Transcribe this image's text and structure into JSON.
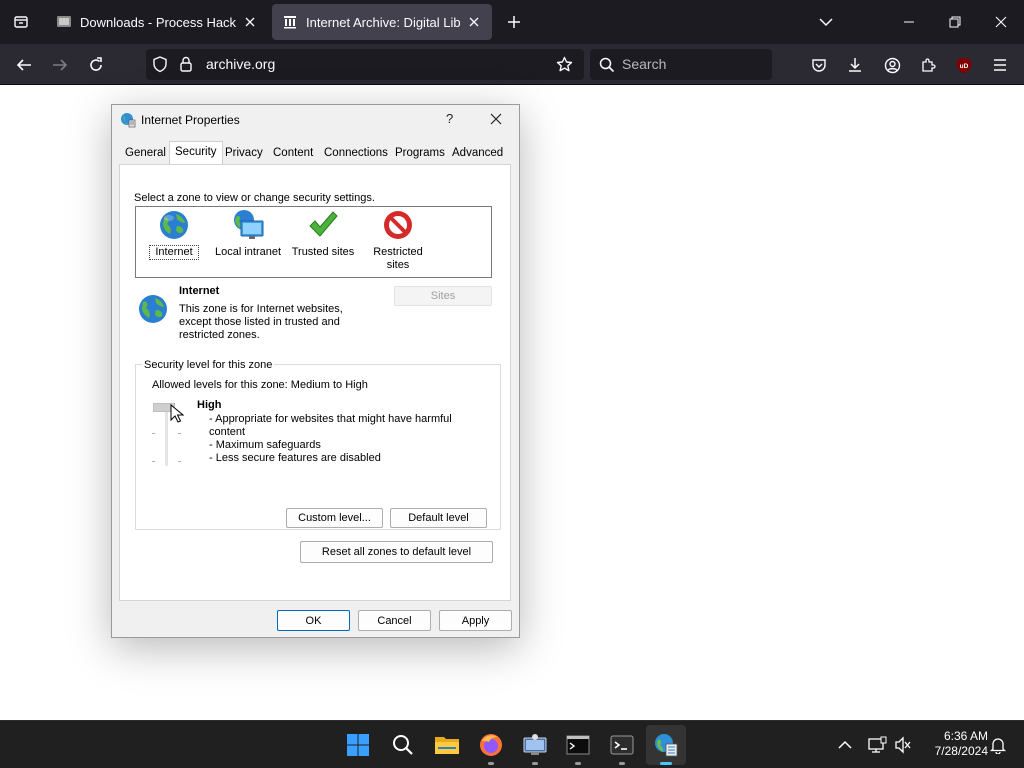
{
  "browser": {
    "tabs": [
      {
        "title": "Downloads - Process Hacker"
      },
      {
        "title": "Internet Archive: Digital Library"
      }
    ],
    "url": "archive.org",
    "search_placeholder": "Search",
    "ublock_badge": "uD"
  },
  "dialog": {
    "title": "Internet Properties",
    "help": "?",
    "tabs": [
      "General",
      "Security",
      "Privacy",
      "Content",
      "Connections",
      "Programs",
      "Advanced"
    ],
    "selected_tab": "Security",
    "zone_prompt": "Select a zone to view or change security settings.",
    "zones": [
      {
        "label": "Internet",
        "icon": "globe-icon"
      },
      {
        "label": "Local intranet",
        "icon": "intranet-icon"
      },
      {
        "label": "Trusted sites",
        "icon": "checkmark-icon"
      },
      {
        "label": "Restricted sites",
        "icon": "restricted-icon"
      }
    ],
    "zone_info": {
      "name": "Internet",
      "description_lines": [
        "This zone is for Internet websites,",
        "except those listed in trusted and",
        "restricted zones."
      ],
      "sites_button": "Sites"
    },
    "security_level": {
      "group_label": "Security level for this zone",
      "allowed": "Allowed levels for this zone: Medium to High",
      "level": "High",
      "details": [
        "- Appropriate for websites that might have harmful",
        "content",
        "- Maximum safeguards",
        "- Less secure features are disabled"
      ],
      "custom_button": "Custom level...",
      "default_button": "Default level"
    },
    "reset_button": "Reset all zones to default level",
    "ok": "OK",
    "cancel": "Cancel",
    "apply": "Apply"
  },
  "taskbar": {
    "time": "6:36 AM",
    "date": "7/28/2024",
    "apps": [
      "start-icon",
      "search-icon",
      "file-explorer-icon",
      "firefox-icon",
      "remote-desktop-icon",
      "cmd-icon",
      "terminal-icon",
      "internet-options-icon"
    ]
  },
  "colors": {
    "chrome_dark": "#1c1b22",
    "toolbar": "#2b2a33",
    "accent": "#0067c0",
    "taskbar": "#202020"
  }
}
